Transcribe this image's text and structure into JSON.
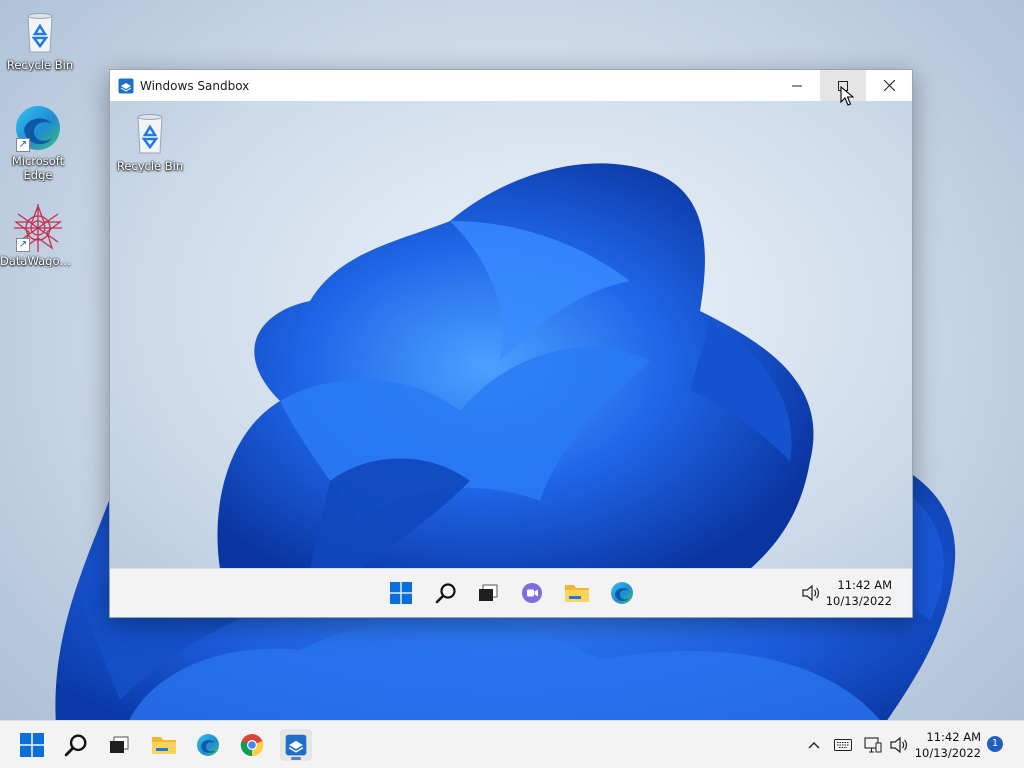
{
  "desktop": {
    "icons": [
      {
        "label": "Recycle Bin"
      },
      {
        "label": "Microsoft Edge"
      },
      {
        "label": "DataWagon..."
      }
    ]
  },
  "sandbox": {
    "title": "Windows Sandbox",
    "desktop_icons": [
      {
        "label": "Recycle Bin"
      }
    ],
    "tray": {
      "time": "11:42 AM",
      "date": "10/13/2022"
    }
  },
  "taskbar": {
    "tray": {
      "time": "11:42 AM",
      "date": "10/13/2022",
      "notification_count": "1"
    }
  },
  "icons": {
    "start": "windows-logo-icon",
    "search": "search-icon",
    "task_view": "task-view-icon",
    "chat": "chat-icon",
    "explorer": "file-explorer-icon",
    "edge": "edge-icon",
    "chrome": "chrome-icon",
    "sandbox": "windows-sandbox-icon"
  },
  "colors": {
    "accent": "#0067c0",
    "wallpaper_bloom": "#1f5fd6",
    "taskbar": "#f3f3f3"
  }
}
